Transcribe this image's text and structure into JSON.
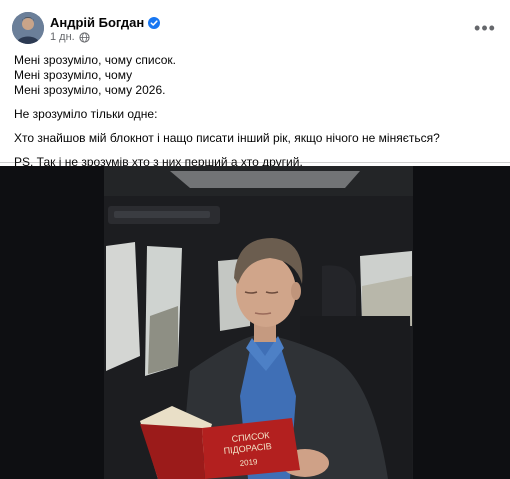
{
  "post": {
    "author": {
      "name": "Андрій Богдан",
      "verified": true
    },
    "meta": {
      "time": "1 дн.",
      "privacy_icon": "globe-icon"
    },
    "more_icon": "more-dots-icon",
    "text": {
      "line1": "Мені зрозуміло, чому список.",
      "line2": "Мені зрозуміло, чому",
      "line3": "Мені зрозуміло, чому 2026.",
      "line4": "Не зрозуміло тільки одне:",
      "line5": "Хто знайшов мій блокнот і нащо писати інший рік, якщо нічого не міняється?",
      "line6": "PS. Так і не зрозумів хто з них перший а хто другий."
    },
    "photo": {
      "book_title_line1": "СПИСОК",
      "book_title_line2": "ПІДОРАСІВ",
      "book_year": "2019"
    }
  },
  "colors": {
    "verified": "#1877f2",
    "book": "#b3201f",
    "shirt": "#3f6fb6",
    "jacket": "#2f3236"
  }
}
